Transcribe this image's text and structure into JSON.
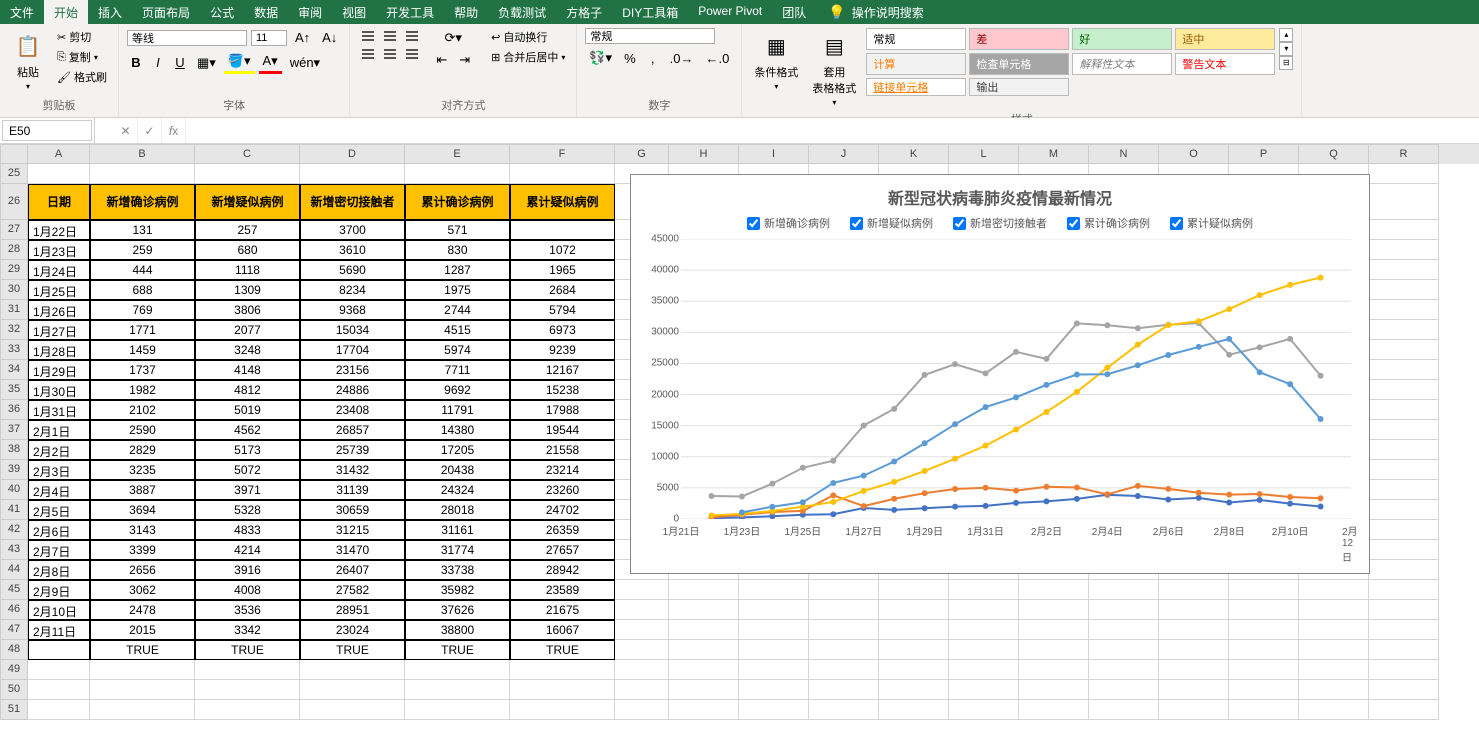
{
  "tabs": [
    "文件",
    "开始",
    "插入",
    "页面布局",
    "公式",
    "数据",
    "审阅",
    "视图",
    "开发工具",
    "帮助",
    "负载测试",
    "方格子",
    "DIY工具箱",
    "Power Pivot",
    "团队"
  ],
  "active_tab": "开始",
  "tell_me": "操作说明搜索",
  "ribbon": {
    "clipboard": {
      "label": "剪贴板",
      "paste": "粘贴",
      "cut": "剪切",
      "copy": "复制",
      "format_painter": "格式刷"
    },
    "font": {
      "label": "字体",
      "name": "等线",
      "size": "11"
    },
    "alignment": {
      "label": "对齐方式",
      "wrap": "自动换行",
      "merge": "合并后居中"
    },
    "number": {
      "label": "数字",
      "format": "常规"
    },
    "cond_format": "条件格式",
    "table_format": "套用\n表格格式",
    "styles": {
      "label": "样式",
      "normal": "常规",
      "bad": "差",
      "good": "好",
      "neutral": "适中",
      "calc": "计算",
      "check": "检查单元格",
      "explan": "解释性文本",
      "warn": "警告文本",
      "linked": "链接单元格",
      "output": "输出"
    }
  },
  "name_box": "E50",
  "columns": [
    "A",
    "B",
    "C",
    "D",
    "E",
    "F",
    "G",
    "H",
    "I",
    "J",
    "K",
    "L",
    "M",
    "N",
    "O",
    "P",
    "Q",
    "R"
  ],
  "row_start": 25,
  "row_end": 51,
  "table": {
    "headers": [
      "日期",
      "新增确诊病例",
      "新增疑似病例",
      "新增密切接触者",
      "累计确诊病例",
      "累计疑似病例"
    ],
    "rows": [
      [
        "1月22日",
        131,
        257,
        3700,
        571,
        ""
      ],
      [
        "1月23日",
        259,
        680,
        3610,
        830,
        1072
      ],
      [
        "1月24日",
        444,
        1118,
        5690,
        1287,
        1965
      ],
      [
        "1月25日",
        688,
        1309,
        8234,
        1975,
        2684
      ],
      [
        "1月26日",
        769,
        3806,
        9368,
        2744,
        5794
      ],
      [
        "1月27日",
        1771,
        2077,
        15034,
        4515,
        6973
      ],
      [
        "1月28日",
        1459,
        3248,
        17704,
        5974,
        9239
      ],
      [
        "1月29日",
        1737,
        4148,
        23156,
        7711,
        12167
      ],
      [
        "1月30日",
        1982,
        4812,
        24886,
        9692,
        15238
      ],
      [
        "1月31日",
        2102,
        5019,
        23408,
        11791,
        17988
      ],
      [
        "2月1日",
        2590,
        4562,
        26857,
        14380,
        19544
      ],
      [
        "2月2日",
        2829,
        5173,
        25739,
        17205,
        21558
      ],
      [
        "2月3日",
        3235,
        5072,
        31432,
        20438,
        23214
      ],
      [
        "2月4日",
        3887,
        3971,
        31139,
        24324,
        23260
      ],
      [
        "2月5日",
        3694,
        5328,
        30659,
        28018,
        24702
      ],
      [
        "2月6日",
        3143,
        4833,
        31215,
        31161,
        26359
      ],
      [
        "2月7日",
        3399,
        4214,
        31470,
        31774,
        27657
      ],
      [
        "2月8日",
        2656,
        3916,
        26407,
        33738,
        28942
      ],
      [
        "2月9日",
        3062,
        4008,
        27582,
        35982,
        23589
      ],
      [
        "2月10日",
        2478,
        3536,
        28951,
        37626,
        21675
      ],
      [
        "2月11日",
        2015,
        3342,
        23024,
        38800,
        16067
      ]
    ],
    "footer": [
      "",
      "TRUE",
      "TRUE",
      "TRUE",
      "TRUE",
      "TRUE"
    ]
  },
  "chart_data": {
    "type": "line",
    "title": "新型冠状病毒肺炎疫情最新情况",
    "ylim": [
      0,
      45000
    ],
    "ytick": 5000,
    "x_labels": [
      "1月21日",
      "1月23日",
      "1月25日",
      "1月27日",
      "1月29日",
      "1月31日",
      "2月2日",
      "2月4日",
      "2月6日",
      "2月8日",
      "2月10日",
      "2月12日"
    ],
    "categories": [
      "1月22日",
      "1月23日",
      "1月24日",
      "1月25日",
      "1月26日",
      "1月27日",
      "1月28日",
      "1月29日",
      "1月30日",
      "1月31日",
      "2月1日",
      "2月2日",
      "2月3日",
      "2月4日",
      "2月5日",
      "2月6日",
      "2月7日",
      "2月8日",
      "2月9日",
      "2月10日",
      "2月11日"
    ],
    "series": [
      {
        "name": "新增确诊病例",
        "color": "#4472C4",
        "values": [
          131,
          259,
          444,
          688,
          769,
          1771,
          1459,
          1737,
          1982,
          2102,
          2590,
          2829,
          3235,
          3887,
          3694,
          3143,
          3399,
          2656,
          3062,
          2478,
          2015
        ]
      },
      {
        "name": "新增疑似病例",
        "color": "#ED7D31",
        "values": [
          257,
          680,
          1118,
          1309,
          3806,
          2077,
          3248,
          4148,
          4812,
          5019,
          4562,
          5173,
          5072,
          3971,
          5328,
          4833,
          4214,
          3916,
          4008,
          3536,
          3342
        ]
      },
      {
        "name": "新增密切接触者",
        "color": "#A5A5A5",
        "values": [
          3700,
          3610,
          5690,
          8234,
          9368,
          15034,
          17704,
          23156,
          24886,
          23408,
          26857,
          25739,
          31432,
          31139,
          30659,
          31215,
          31470,
          26407,
          27582,
          28951,
          23024
        ]
      },
      {
        "name": "累计确诊病例",
        "color": "#FFC000",
        "values": [
          571,
          830,
          1287,
          1975,
          2744,
          4515,
          5974,
          7711,
          9692,
          11791,
          14380,
          17205,
          20438,
          24324,
          28018,
          31161,
          31774,
          33738,
          35982,
          37626,
          38800
        ]
      },
      {
        "name": "累计疑似病例",
        "color": "#5B9BD5",
        "values": [
          null,
          1072,
          1965,
          2684,
          5794,
          6973,
          9239,
          12167,
          15238,
          17988,
          19544,
          21558,
          23214,
          23260,
          24702,
          26359,
          27657,
          28942,
          23589,
          21675,
          16067
        ]
      }
    ]
  }
}
